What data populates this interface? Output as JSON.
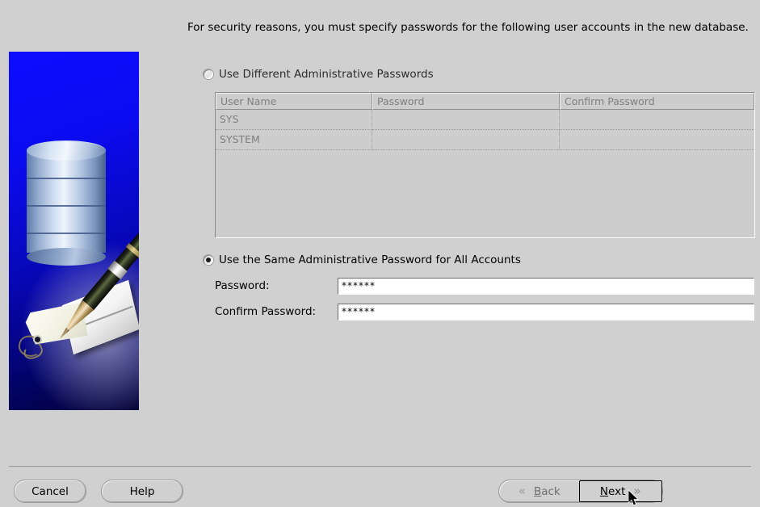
{
  "intro": {
    "text": "For security reasons, you must specify passwords for the following user accounts in the new database."
  },
  "options": {
    "different": {
      "label": "Use Different Administrative Passwords",
      "selected": false,
      "icon": "radio-unselected-icon"
    },
    "same": {
      "label": "Use the Same Administrative Password for All Accounts",
      "selected": true,
      "icon": "radio-selected-icon"
    }
  },
  "table": {
    "columns": [
      "User Name",
      "Password",
      "Confirm Password"
    ],
    "rows": [
      {
        "user_name": "SYS",
        "password": "",
        "confirm_password": ""
      },
      {
        "user_name": "SYSTEM",
        "password": "",
        "confirm_password": ""
      }
    ],
    "enabled": false
  },
  "form": {
    "password": {
      "label": "Password:",
      "value": "******",
      "placeholder": ""
    },
    "confirm_password": {
      "label": "Confirm Password:",
      "value": "******",
      "placeholder": ""
    }
  },
  "buttons": {
    "cancel": "Cancel",
    "help": "Help",
    "back": "Back",
    "next": "Next",
    "back_icon": "chevron-double-left-icon",
    "next_icon": "chevron-double-right-icon",
    "back_chevron": "«",
    "next_chevron": "»"
  },
  "colors": {
    "window_background": "#d0d0d0",
    "panel_blue_light": "#0d0dff",
    "panel_blue_dark": "#010135",
    "field_background": "#ffffff",
    "disabled_text": "#7f7f7f",
    "focus_border": "#000000"
  },
  "illustration": {
    "name": "database-pen-label-illustration"
  }
}
